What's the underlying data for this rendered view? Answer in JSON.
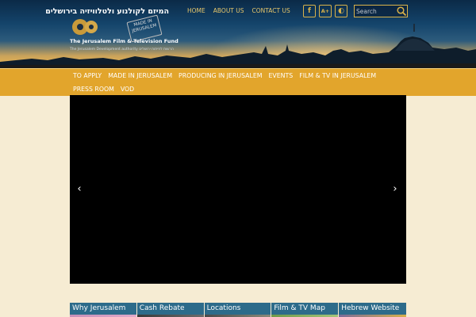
{
  "header": {
    "logo": {
      "hebrew_name": "המיזם לקולנוע ולטלוויזיה בירושלים",
      "stamp_text": "MADE IN JERUSALEM",
      "english_name": "The Jerusalem Film & Television Fund",
      "subtitle": "The Jerusalem Development authority  הרשות לפיתוח ירושלים"
    },
    "top_nav": [
      "HOME",
      "ABOUT US",
      "CONTACT US"
    ],
    "social": {
      "facebook_glyph": "f",
      "accessibility_glyph": "A+",
      "contrast_glyph": "◐"
    },
    "search": {
      "placeholder": "Search"
    },
    "colors": {
      "accent": "#d9b24a",
      "link": "#e8c76b"
    }
  },
  "main_nav": {
    "items": [
      "TO APPLY",
      "MADE IN JERUSALEM",
      "PRODUCING IN JERUSALEM",
      "EVENTS",
      "FILM & TV IN JERUSALEM",
      "PRESS ROOM",
      "VOD"
    ],
    "background": "#e2a52c"
  },
  "slider": {
    "prev_glyph": "‹",
    "next_glyph": "›"
  },
  "tabs": [
    "Why Jerusalem",
    "Cash Rebate",
    "Locations",
    "Film & TV Map",
    "Hebrew Website"
  ]
}
